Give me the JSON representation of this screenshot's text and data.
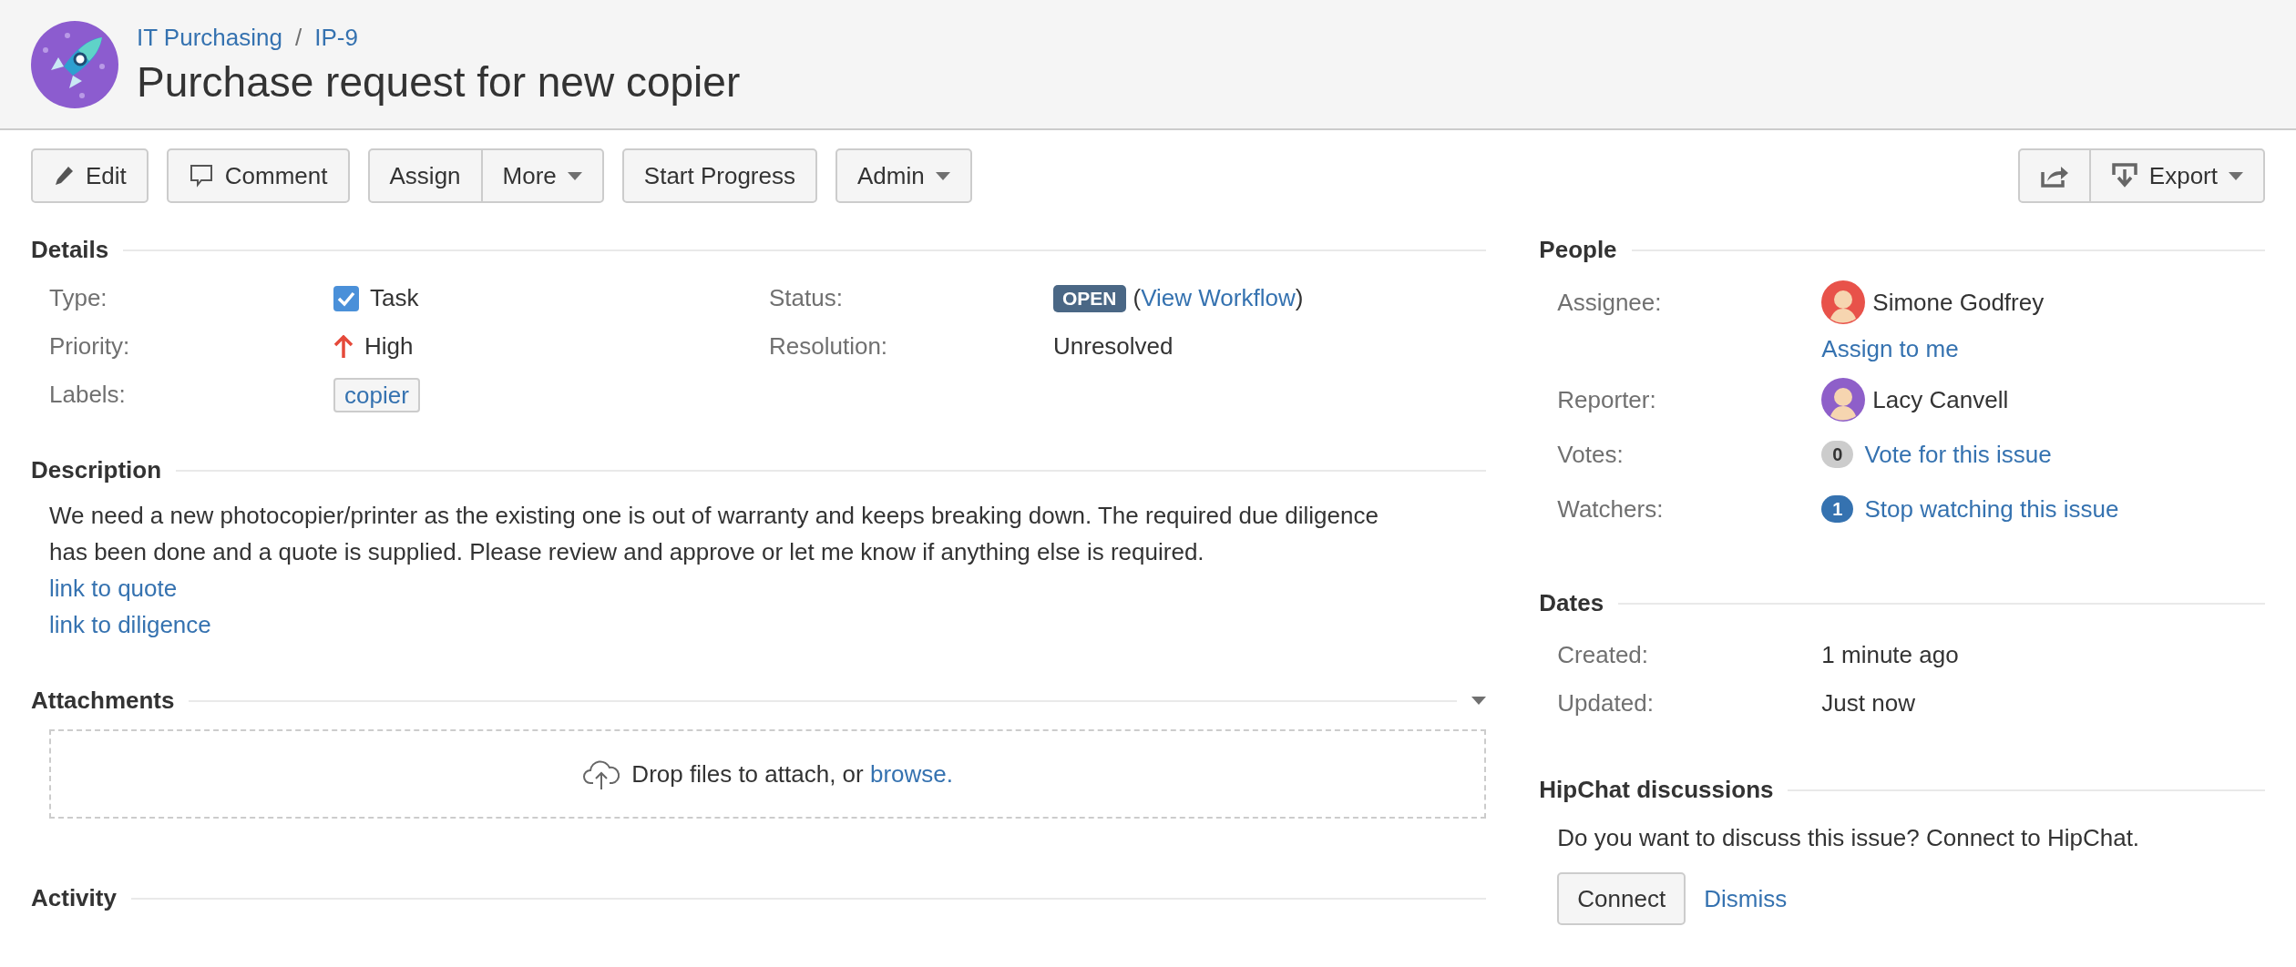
{
  "header": {
    "breadcrumbs": [
      "IT Purchasing",
      "IP-9"
    ],
    "separator": "/",
    "title": "Purchase request for new copier"
  },
  "toolbar": {
    "left": [
      [
        {
          "label": "Edit",
          "kind": "pencil"
        }
      ],
      [
        {
          "label": "Comment",
          "kind": "comment"
        }
      ],
      [
        {
          "label": "Assign"
        },
        {
          "label": "More",
          "dropdown": true
        }
      ],
      [
        {
          "label": "Start Progress"
        }
      ],
      [
        {
          "label": "Admin",
          "dropdown": true
        }
      ]
    ],
    "right": [
      [
        {
          "kind": "share"
        },
        {
          "label": "Export",
          "kind": "download",
          "dropdown": true
        }
      ]
    ]
  },
  "details": {
    "heading": "Details",
    "fields": [
      {
        "label": "Type:",
        "kind": "type",
        "value": "Task"
      },
      {
        "label": "Status:",
        "kind": "status",
        "value": "OPEN",
        "before": "(",
        "link": "View Workflow",
        "after": ")"
      },
      {
        "label": "Priority:",
        "kind": "priority",
        "value": "High"
      },
      {
        "label": "Resolution:",
        "kind": "text",
        "value": "Unresolved"
      },
      {
        "label": "Labels:",
        "kind": "labels",
        "value": "copier"
      }
    ]
  },
  "description": {
    "heading": "Description",
    "text": "We need a new photocopier/printer as the existing one is out of warranty and keeps breaking down. The required due diligence has been done and a quote is supplied. Please review and approve or let me know if anything else is required.",
    "links": [
      "link to quote",
      "link to diligence"
    ]
  },
  "attachments": {
    "heading": "Attachments",
    "drop_text": "Drop files to attach, or ",
    "browse": "browse."
  },
  "activity": {
    "heading": "Activity"
  },
  "people": {
    "heading": "People",
    "fields": [
      {
        "label": "Assignee:",
        "kind": "person",
        "name": "Simone Godfrey",
        "color": "#e8524a",
        "action": "Assign to me"
      },
      {
        "label": "Reporter:",
        "kind": "person",
        "name": "Lacy Canvell",
        "color": "#8e5fc9"
      },
      {
        "label": "Votes:",
        "kind": "count",
        "count": "0",
        "on": false,
        "link": "Vote for this issue"
      },
      {
        "label": "Watchers:",
        "kind": "count",
        "count": "1",
        "on": true,
        "link": "Stop watching this issue"
      }
    ]
  },
  "dates": {
    "heading": "Dates",
    "fields": [
      {
        "label": "Created:",
        "value": "1 minute ago"
      },
      {
        "label": "Updated:",
        "value": "Just now"
      }
    ]
  },
  "hipchat": {
    "heading": "HipChat discussions",
    "text": "Do you want to discuss this issue? Connect to HipChat.",
    "button": "Connect",
    "link": "Dismiss"
  }
}
